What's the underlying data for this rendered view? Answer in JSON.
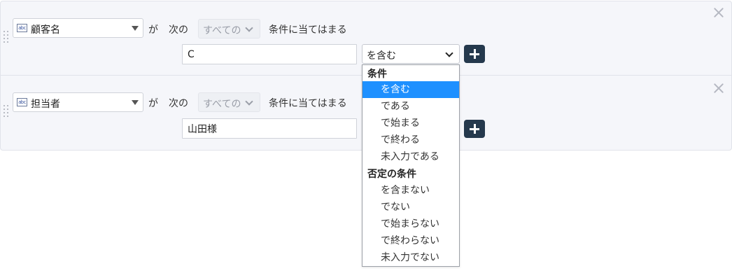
{
  "rows": [
    {
      "field": {
        "icon": "abc-text-field-icon",
        "label": "顧客名"
      },
      "connector": "が",
      "next_label": "次の",
      "scope": "すべての",
      "condition_suffix": "条件に当てはまる",
      "value": "C",
      "operator": "を含む"
    },
    {
      "field": {
        "icon": "abc-text-field-icon",
        "label": "担当者"
      },
      "connector": "が",
      "next_label": "次の",
      "scope": "すべての",
      "condition_suffix": "条件に当てはまる",
      "value": "山田様"
    }
  ],
  "icon_text": "abc",
  "operator_dropdown": {
    "groups": [
      {
        "label": "条件",
        "options": [
          "を含む",
          "である",
          "で始まる",
          "で終わる",
          "未入力である"
        ]
      },
      {
        "label": "否定の条件",
        "options": [
          "を含まない",
          "でない",
          "で始まらない",
          "で終わらない",
          "未入力でない"
        ]
      }
    ],
    "selected": "を含む"
  },
  "colors": {
    "panel_background": "#f5f6fa",
    "add_button": "#25394d",
    "highlight": "#1e90ff"
  }
}
